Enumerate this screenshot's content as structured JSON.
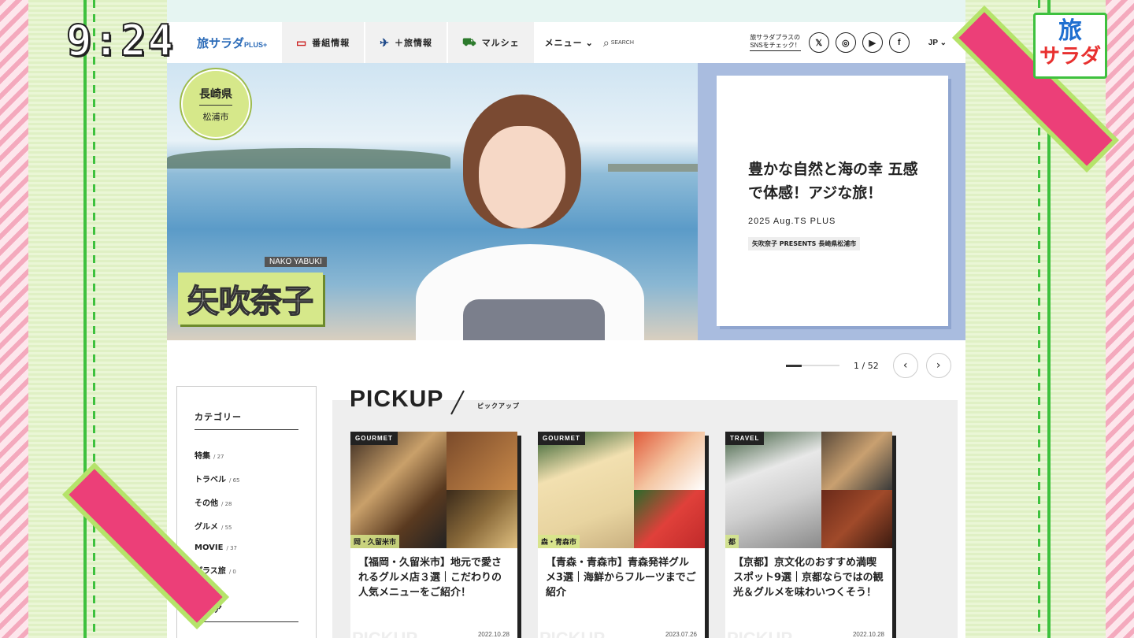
{
  "overlay": {
    "clock": "9:24",
    "tv_logo_line1": "旅",
    "tv_logo_line2": "サラダ"
  },
  "site": {
    "logo": "旅サラダ",
    "logo_suffix": "PLUS+",
    "nav": [
      {
        "label": "番組情報",
        "icon": "tv-icon"
      },
      {
        "label": "＋旅情報",
        "icon": "airplane-icon"
      },
      {
        "label": "マルシェ",
        "icon": "cart-icon"
      }
    ],
    "menu_label": "メニュー",
    "search_label": "SEARCH",
    "sns_note": "旅サラダプラスの\nSNSをチェック！",
    "sns": [
      {
        "name": "x",
        "glyph": "𝕏"
      },
      {
        "name": "instagram",
        "glyph": "◎"
      },
      {
        "name": "youtube",
        "glyph": "▶"
      },
      {
        "name": "facebook",
        "glyph": "f"
      }
    ],
    "lang": "JP"
  },
  "hero": {
    "prefecture": "長崎県",
    "city": "松浦市",
    "name_en": "NAKO YABUKI",
    "name_jp": "矢吹奈子",
    "title": "豊かな自然と海の幸 五感で体感！アジな旅！",
    "date": "2025 Aug.TS PLUS",
    "tag": "矢吹奈子 PRESENTS 長崎県松浦市",
    "pager_text": "1 / 52"
  },
  "sidebar": {
    "category_heading": "カテゴリー",
    "categories": [
      {
        "label": "特集",
        "count": "/ 27"
      },
      {
        "label": "トラベル",
        "count": "/ 65"
      },
      {
        "label": "その他",
        "count": "/ 28"
      },
      {
        "label": "グルメ",
        "count": "/ 55"
      },
      {
        "label": "MOVIE",
        "count": "/ 37"
      },
      {
        "label": "プラス旅",
        "count": "/ 0"
      }
    ],
    "area_heading": "エリア"
  },
  "pickup": {
    "title": "PICKUP",
    "subtitle": "ピックアップ",
    "cards": [
      {
        "badge": "GOURMET",
        "loc": "岡・久留米市",
        "title": "【福岡・久留米市】地元で愛されるグルメ店３選｜こだわりの人気メニューをご紹介！",
        "date": "2022.10.28",
        "wm": "PICKUP"
      },
      {
        "badge": "GOURMET",
        "loc": "森・青森市",
        "title": "【青森・青森市】青森発祥グルメ3選｜海鮮からフルーツまでご紹介",
        "date": "2023.07.26",
        "wm": "PICKUP"
      },
      {
        "badge": "TRAVEL",
        "loc": "都",
        "title": "【京都】京文化のおすすめ満喫スポット9選｜京都ならではの観光＆グルメを味わいつくそう！",
        "date": "2022.10.28",
        "wm": "PICKUP"
      }
    ]
  }
}
